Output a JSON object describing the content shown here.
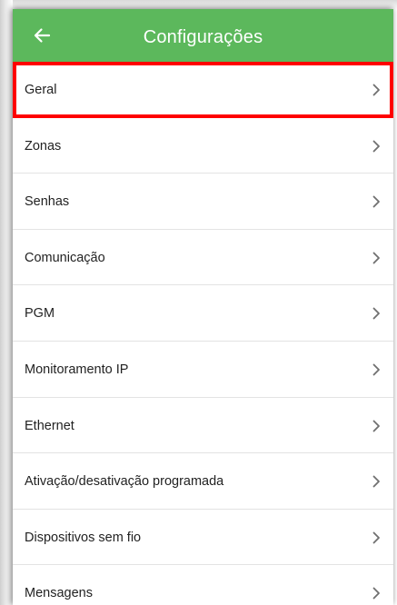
{
  "app_bar": {
    "title": "Configurações",
    "back_icon": "arrow-left-icon",
    "color": "#5cb85c"
  },
  "menu": {
    "chevron_icon": "chevron-right-icon",
    "highlight_color": "#ff0000",
    "items": [
      {
        "label": "Geral",
        "highlighted": true
      },
      {
        "label": "Zonas"
      },
      {
        "label": "Senhas"
      },
      {
        "label": "Comunicação"
      },
      {
        "label": "PGM"
      },
      {
        "label": "Monitoramento IP"
      },
      {
        "label": "Ethernet"
      },
      {
        "label": "Ativação/desativação programada"
      },
      {
        "label": "Dispositivos sem fio"
      },
      {
        "label": "Mensagens"
      }
    ]
  }
}
